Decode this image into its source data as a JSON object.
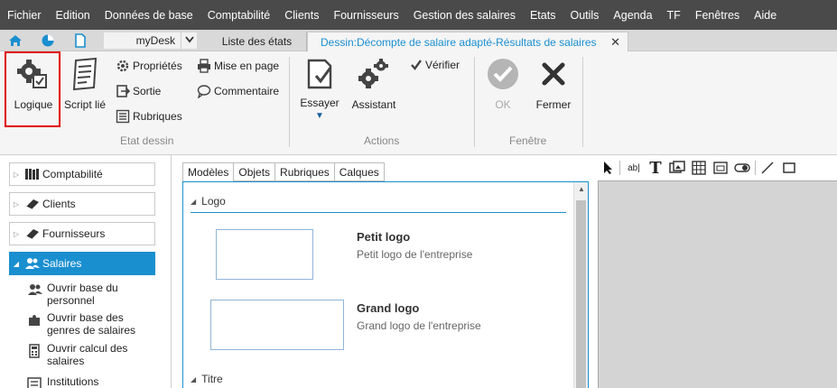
{
  "menu": [
    "Fichier",
    "Edition",
    "Données de base",
    "Comptabilité",
    "Clients",
    "Fournisseurs",
    "Gestion des salaires",
    "Etats",
    "Outils",
    "Agenda",
    "TF",
    "Fenêtres",
    "Aide"
  ],
  "tabbar": {
    "mydesk": "myDesk",
    "tab_liste": "Liste des états",
    "tab_active": "Dessin:Décompte de salaire adapté-Résultats de salaires"
  },
  "ribbon": {
    "logique": "Logique",
    "script": "Script lié",
    "proprietes": "Propriétés",
    "sortie": "Sortie",
    "rubriques": "Rubriques",
    "mise_en_page": "Mise en page",
    "commentaire": "Commentaire",
    "group_etat": "Etat dessin",
    "essayer": "Essayer",
    "assistant": "Assistant",
    "verifier": "Vérifier",
    "group_actions": "Actions",
    "ok": "OK",
    "fermer": "Fermer",
    "group_fenetre": "Fenêtre"
  },
  "nav": {
    "comptabilite": "Comptabilité",
    "clients": "Clients",
    "fournisseurs": "Fournisseurs",
    "salaires": "Salaires",
    "sub": [
      {
        "l1": "Ouvrir base du",
        "l2": "personnel"
      },
      {
        "l1": "Ouvrir base des",
        "l2": "genres de salaires"
      },
      {
        "l1": "Ouvrir calcul des",
        "l2": "salaires"
      },
      {
        "l1": "Institutions",
        "l2": ""
      }
    ]
  },
  "center": {
    "tabs": [
      "Modèles",
      "Objets",
      "Rubriques",
      "Calques"
    ],
    "section_logo": "Logo",
    "petit_logo_title": "Petit logo",
    "petit_logo_desc": "Petit logo de l'entreprise",
    "grand_logo_title": "Grand logo",
    "grand_logo_desc": "Grand logo de l'entreprise",
    "section_titre": "Titre"
  },
  "colors": {
    "menubar": "#4a4a4a",
    "accent": "#1a8fd0",
    "highlight": "#e00000"
  }
}
